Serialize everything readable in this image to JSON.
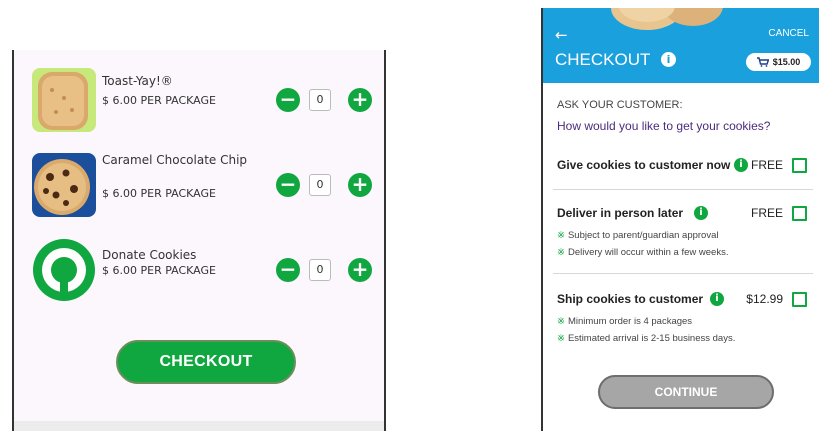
{
  "left_panel": {
    "products": [
      {
        "name": "Toast-Yay!®",
        "price": "$ 6.00 PER PACKAGE",
        "qty": "0",
        "image": "toast-yay-cookie-icon"
      },
      {
        "name": "Caramel Chocolate Chip",
        "price": "$ 6.00 PER PACKAGE",
        "qty": "0",
        "image": "caramel-chocolate-chip-cookie-icon"
      },
      {
        "name": "Donate Cookies",
        "price": "$ 6.00 PER PACKAGE",
        "qty": "0",
        "image": "girl-scouts-trefoil-icon"
      }
    ],
    "stepper": {
      "minus": "−",
      "plus": "+"
    },
    "checkout_label": "CHECKOUT",
    "colors": {
      "accent_green": "#10a640",
      "panel_bg": "#fcf7fc"
    }
  },
  "right_panel": {
    "back_icon": "←",
    "cancel_label": "CANCEL",
    "title": "CHECKOUT",
    "info_glyph": "i",
    "cart_total": "$15.00",
    "ask_label": "ASK YOUR CUSTOMER:",
    "question": "How would you like to get your cookies?",
    "options": [
      {
        "title": "Give cookies to customer now",
        "price": "FREE",
        "notes": []
      },
      {
        "title": "Deliver in person later",
        "price": "FREE",
        "notes": [
          "Subject to parent/guardian approval",
          "Delivery will occur within a few weeks."
        ]
      },
      {
        "title": "Ship cookies to customer",
        "price": "$12.99",
        "notes": [
          "Minimum order is 4 packages",
          "Estimated arrival is 2-15 business days."
        ]
      }
    ],
    "note_mark": "※",
    "continue_label": "CONTINUE",
    "colors": {
      "header_blue": "#1aa0dc",
      "question_purple": "#4a2c80",
      "continue_disabled": "#a6a6a6"
    }
  }
}
